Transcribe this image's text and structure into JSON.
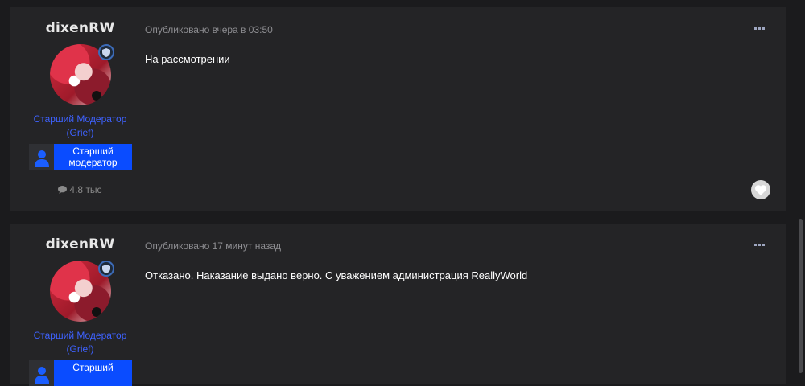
{
  "posts": [
    {
      "username": "dixenRW",
      "role_line1": "Старший Модератор",
      "role_line2": "(Grief)",
      "group_line1": "Старший",
      "group_line2": "модератор",
      "post_count": "4.8 тыс",
      "published": "Опубликовано вчера в 03:50",
      "content": "На рассмотрении"
    },
    {
      "username": "dixenRW",
      "role_line1": "Старший Модератор",
      "role_line2": "(Grief)",
      "group_line1": "Старший",
      "published": "Опубликовано 17 минут назад",
      "content": "Отказано. Наказание выдано верно. С уважением администрация ReallyWorld"
    }
  ],
  "icons": {
    "rank": "shield-icon",
    "group": "user-silhouette-icon",
    "count": "speech-bubble-icon",
    "menu": "ellipsis-icon",
    "like": "heart-icon"
  },
  "colors": {
    "page_bg": "#1b1b1d",
    "post_bg": "#242426",
    "role_text": "#3e62ff",
    "group_bg": "#0a4cff"
  }
}
